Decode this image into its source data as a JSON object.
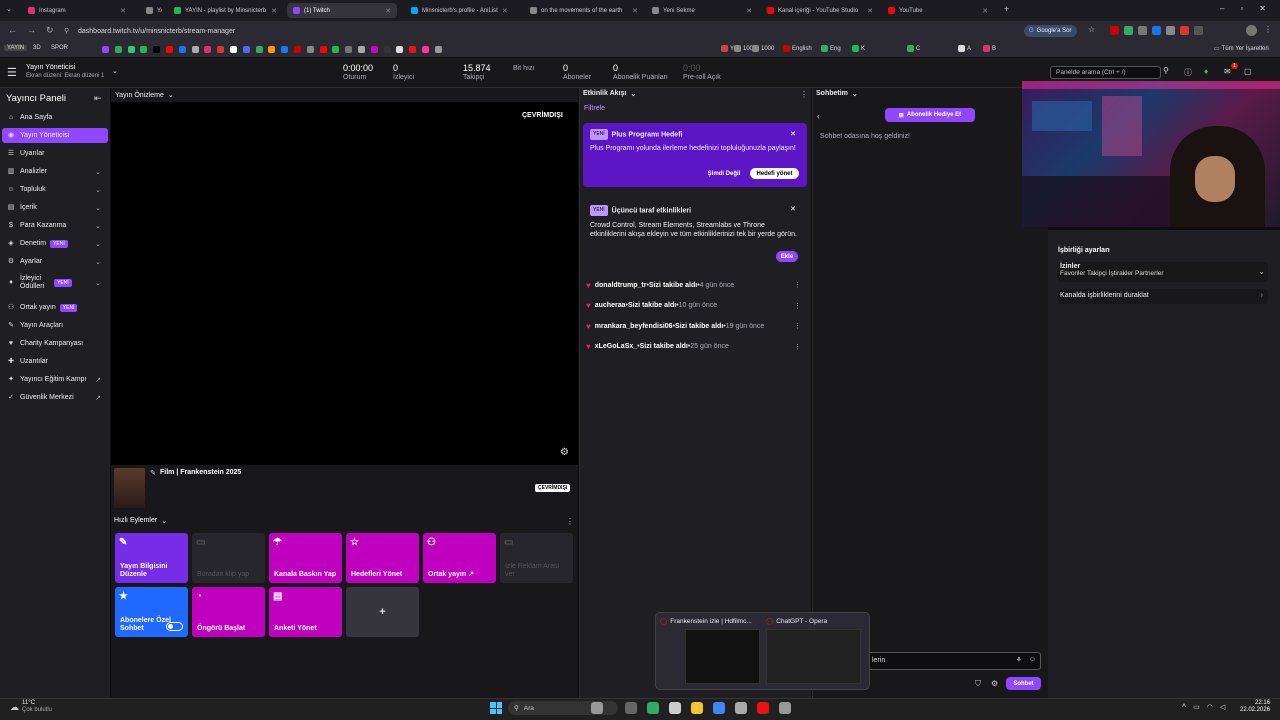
{
  "browser": {
    "tabs": [
      {
        "title": "Instagram",
        "color": "#e1306c",
        "active": false
      },
      {
        "title": "YAYIN",
        "color": "#888888",
        "active": false
      },
      {
        "title": "YAYIN - playlist by Minsnicterb",
        "color": "#1db954",
        "active": false
      },
      {
        "title": "(1) Twitch",
        "color": "#9147ff",
        "active": true
      },
      {
        "title": "Minsnicterb's profile - AniList",
        "color": "#02a9ff",
        "active": false
      },
      {
        "title": "on the movements of the earth",
        "color": "#888888",
        "active": false
      },
      {
        "title": "Yeni Sekme",
        "color": "#888888",
        "active": false
      },
      {
        "title": "Kanal içeriği - YouTube Studio",
        "color": "#ff0000",
        "active": false
      },
      {
        "title": "YouTube",
        "color": "#ff0000",
        "active": false
      }
    ],
    "url": "dashboard.twitch.tv/u/minsnicterb/stream-manager",
    "google_btn": "Google'a Sor",
    "bookmarks": [
      "YAYIN",
      "3D",
      "SPOR",
      "Yer",
      "100",
      "1000",
      "English",
      "Eng",
      "K",
      "C",
      "A",
      "B"
    ],
    "all_bookmarks": "Tüm Yer İşaretleri"
  },
  "topnav": {
    "title": "Yayın Yöneticisi",
    "subtitle": "Ekran düzeni: Ekran düzeni 1",
    "stats": [
      {
        "value": "0:00:00",
        "label": "Oturum"
      },
      {
        "value": "0",
        "label": "İzleyici"
      },
      {
        "value": "15.874",
        "label": "Takipçi"
      },
      {
        "value": "",
        "label": "Bit hızı"
      },
      {
        "value": "0",
        "label": "Aboneler"
      },
      {
        "value": "0",
        "label": "Abonelik Puanları"
      },
      {
        "value": "0:00",
        "label": "Pre-roll Açık"
      }
    ],
    "search_placeholder": "Panelde arama (Ctrl + /)",
    "notif_count": "1"
  },
  "sidebar": {
    "title": "Yayıncı Paneli",
    "items": [
      {
        "label": "Ana Sayfa",
        "icon": "home-icon",
        "glyph": "⌂",
        "chev": "",
        "badge": ""
      },
      {
        "label": "Yayın Yöneticisi",
        "icon": "broadcast-icon",
        "glyph": "◉",
        "chev": "",
        "badge": ""
      },
      {
        "label": "Uyarılar",
        "icon": "alert-icon",
        "glyph": "☰",
        "chev": "",
        "badge": ""
      },
      {
        "label": "Analizler",
        "icon": "chart-icon",
        "glyph": "▥",
        "chev": "⌄",
        "badge": ""
      },
      {
        "label": "Topluluk",
        "icon": "community-icon",
        "glyph": "☺",
        "chev": "⌄",
        "badge": ""
      },
      {
        "label": "İçerik",
        "icon": "content-icon",
        "glyph": "▤",
        "chev": "⌄",
        "badge": ""
      },
      {
        "label": "Para Kazanma",
        "icon": "money-icon",
        "glyph": "$",
        "chev": "⌄",
        "badge": ""
      },
      {
        "label": "Denetim",
        "icon": "shield-icon",
        "glyph": "◈",
        "chev": "⌄",
        "badge": "YENİ"
      },
      {
        "label": "Ayarlar",
        "icon": "gear-icon",
        "glyph": "⚙",
        "chev": "⌄",
        "badge": ""
      },
      {
        "label": "İzleyici Ödülleri",
        "icon": "gift-icon",
        "glyph": "♦",
        "chev": "⌄",
        "badge": "YENİ"
      },
      {
        "label": "Ortak yayın",
        "icon": "collab-icon",
        "glyph": "⚇",
        "chev": "",
        "badge": "YENİ"
      },
      {
        "label": "Yayın Araçları",
        "icon": "tools-icon",
        "glyph": "✎",
        "chev": "",
        "badge": ""
      },
      {
        "label": "Charity Kampanyası",
        "icon": "heart-icon",
        "glyph": "♥",
        "chev": "",
        "badge": ""
      },
      {
        "label": "Uzantılar",
        "icon": "extension-icon",
        "glyph": "✚",
        "chev": "",
        "badge": ""
      },
      {
        "label": "Yayıncı Eğitim Kampı",
        "icon": "school-icon",
        "glyph": "✦",
        "chev": "↗",
        "badge": ""
      },
      {
        "label": "Güvenlik Merkezi",
        "icon": "lock-icon",
        "glyph": "✓",
        "chev": "↗",
        "badge": ""
      }
    ]
  },
  "preview": {
    "header": "Yayın Önizleme",
    "offline": "ÇEVRİMDIŞI",
    "stream_title": "Film | Frankenstein 2025",
    "offline_badge": "ÇEVRİMDIŞI"
  },
  "quick_actions": {
    "header": "Hızlı Eylemler",
    "items": [
      {
        "label": "Yayın Bilgisini Düzenle",
        "glyph": "✎",
        "color": "purple"
      },
      {
        "label": "Buradan klip yap",
        "glyph": "▭",
        "color": "disabled"
      },
      {
        "label": "Kanala Baskın Yap",
        "glyph": "☂",
        "color": "magenta"
      },
      {
        "label": "Hedefleri Yönet",
        "glyph": "☆",
        "color": "magenta"
      },
      {
        "label": "Ortak yayın ↗",
        "glyph": "⚇",
        "color": "magenta"
      },
      {
        "label": "İzle Reklam Arası ver",
        "glyph": "▭",
        "color": "disabled"
      },
      {
        "label": "Abonelere Özel Sohbet",
        "glyph": "★",
        "color": "blue"
      },
      {
        "label": "Öngörü Başlat",
        "glyph": "◔",
        "color": "magenta"
      },
      {
        "label": "Anketi Yönet",
        "glyph": "▤",
        "color": "magenta"
      }
    ],
    "add": "+"
  },
  "activity": {
    "header": "Etkinlik Akışı",
    "filter": "Filtrele",
    "plus_card": {
      "badge": "YENİ",
      "title": "Plus Programı Hedefi",
      "body": "Plus Programı yolunda ilerleme hedefinizi topluluğunuzla paylaşın!",
      "btn1": "Şimdi Değil",
      "btn2": "Hedefi yönet"
    },
    "third_card": {
      "badge": "YENİ",
      "title": "Üçüncü taraf etkinlikleri",
      "body": "Crowd Control, Stream Elements, Streamlabs ve Throne etkinliklerini akışa ekleyin ve tüm etkinliklerinizi tek bir yerde görün.",
      "btn": "Ekle"
    },
    "events": [
      {
        "user": "donaldtrump_tr",
        "action": "Sizi takibe aldı",
        "time": "4 gün önce"
      },
      {
        "user": "aucheraa",
        "action": "Sizi takibe aldı",
        "time": "10 gün önce"
      },
      {
        "user": "mrankara_beyfendisi06",
        "action": "Sizi takibe aldı",
        "time": "19 gün önce"
      },
      {
        "user": "xLeGoLaSx_",
        "action": "Sizi takibe aldı",
        "time": "25 gün önce"
      }
    ]
  },
  "chat": {
    "header": "Sohbetim",
    "gift_btn": "Abonelik Hediye Et",
    "welcome": "Sohbet odasına hoş geldiniz!",
    "input_text": "lerin",
    "send": "Sohbet"
  },
  "collab": {
    "title": "İşbirliği ayarları",
    "perm_title": "İzinler",
    "perm_sub": "Favoriler Takipçi İştirakler Partnerler",
    "stop": "Kanalda işbirliklerini duraklat"
  },
  "popup": {
    "items": [
      {
        "title": "Frankenstein izle | Hdfilmc..."
      },
      {
        "title": "ChatGPT - Opera"
      }
    ]
  },
  "taskbar": {
    "weather_temp": "11°C",
    "weather_desc": "Çok bulutlu",
    "search": "Ara",
    "time": "22:16",
    "date": "22.02.2026"
  }
}
